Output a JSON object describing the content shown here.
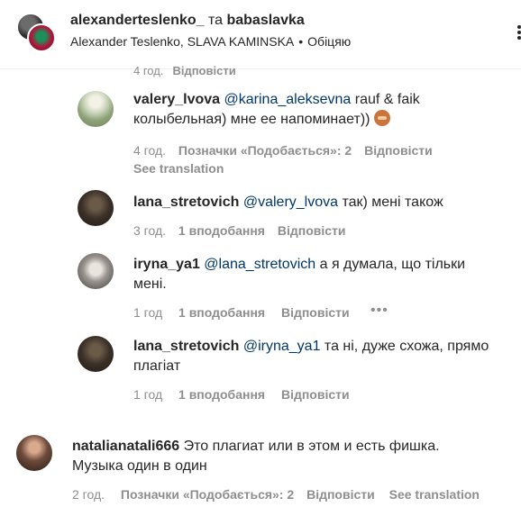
{
  "header": {
    "user1": "alexanderteslenko_",
    "joiner": "та",
    "user2": "babaslavka",
    "names": "Alexander Teslenko, SLAVA KAMINSKA",
    "dot": "•",
    "audio": "Обіцяю"
  },
  "ghost_meta": {
    "time": "4 год.",
    "reply": "Відповісти"
  },
  "comments": [
    {
      "username": "valery_lvova",
      "mention": "@karina_aleksevna",
      "text_line1": " rauf & faik",
      "text_line2": "колыбельная) мне ее напоминает))",
      "emoji": "monkey-covering-eyes",
      "time": "4 год.",
      "likes": "Позначки «Подобається»: 2",
      "reply": "Відповісти",
      "translate": "See translation"
    },
    {
      "username": "lana_stretovich",
      "mention": "@valery_lvova",
      "text_line1": " так) мені також",
      "time": "3 год.",
      "likes": "1 вподобання",
      "reply": "Відповісти"
    },
    {
      "username": "iryna_ya1",
      "mention": "@lana_stretovich",
      "text_line1": " а я думала, що тільки",
      "text_line2": "мені.",
      "time": "1 год",
      "likes": "1 вподобання",
      "reply": "Відповісти",
      "more": "•••"
    },
    {
      "username": "lana_stretovich",
      "mention": "@iryna_ya1",
      "text_line1": " та ні, дуже схожа, прямо",
      "text_line2": "плагіат",
      "time": "1 год",
      "likes": "1 вподобання",
      "reply": "Відповісти"
    },
    {
      "username": "natalianatali666",
      "text_line1": " Это плагиат или в этом и есть фишка.",
      "text_line2": "Музыка один в один",
      "time": "2 год.",
      "likes": "Позначки «Подобається»: 2",
      "reply": "Відповісти",
      "translate": "See translation"
    }
  ]
}
